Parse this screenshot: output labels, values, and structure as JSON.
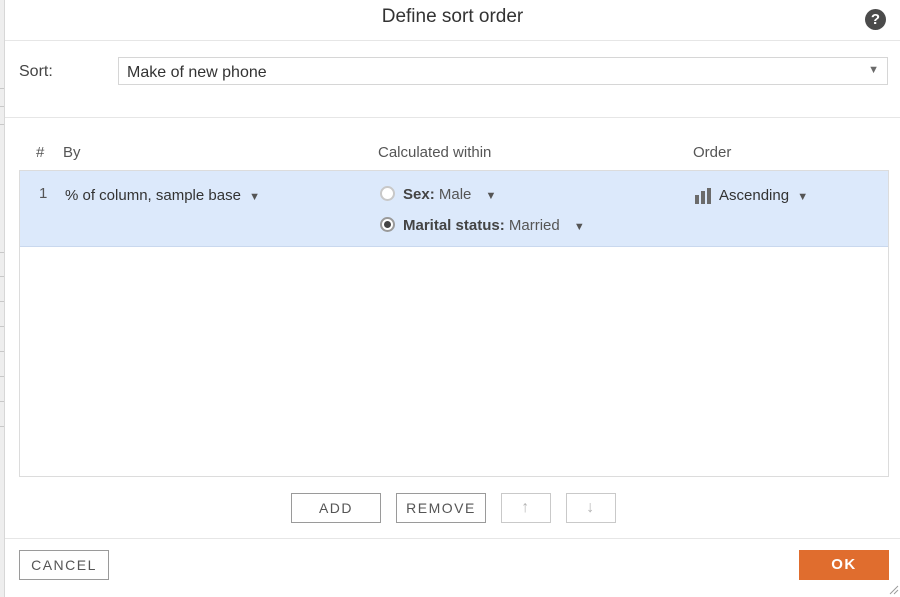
{
  "dialog": {
    "title": "Define sort order",
    "help_icon": "?"
  },
  "sort": {
    "label": "Sort:",
    "value": "Make of new phone"
  },
  "table": {
    "headers": {
      "index": "#",
      "by": "By",
      "within": "Calculated within",
      "order": "Order"
    },
    "rows": [
      {
        "index": "1",
        "by": "% of column, sample base",
        "within": [
          {
            "variable": "Sex:",
            "value": "Male",
            "selected": false
          },
          {
            "variable": "Marital status:",
            "value": "Married",
            "selected": true
          }
        ],
        "order": "Ascending",
        "order_icon": "bar-chart-icon"
      }
    ]
  },
  "buttons": {
    "add": "ADD",
    "remove": "REMOVE",
    "move_up": "↑",
    "move_down": "↓",
    "cancel": "CANCEL",
    "ok": "OK"
  },
  "colors": {
    "accent": "#e06d2e",
    "selected_row": "#dce9fb"
  },
  "caret": "▼"
}
